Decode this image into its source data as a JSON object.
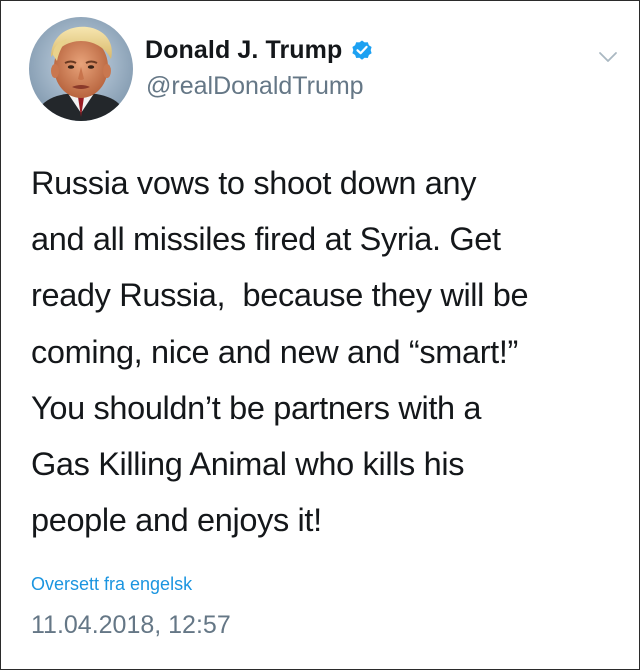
{
  "author": {
    "display_name": "Donald J. Trump",
    "handle": "@realDonaldTrump",
    "verified": true,
    "avatar_icon": "profile-photo"
  },
  "tweet": {
    "lines": [
      "Russia vows to shoot down any",
      "and all missiles fired at Syria. Get",
      "ready Russia,  because they will be",
      "coming, nice and new and “smart!”",
      "You shouldn’t be partners with a",
      "Gas Killing Animal who kills his",
      "people and enjoys it!"
    ],
    "translate_label": "Oversett fra engelsk",
    "timestamp": "11.04.2018, 12:57"
  },
  "icons": {
    "verified": "verified-badge-icon",
    "menu": "chevron-down-icon"
  },
  "colors": {
    "text": "#14171a",
    "secondary": "#657786",
    "link": "#1b95e0",
    "verified": "#1da1f2"
  }
}
